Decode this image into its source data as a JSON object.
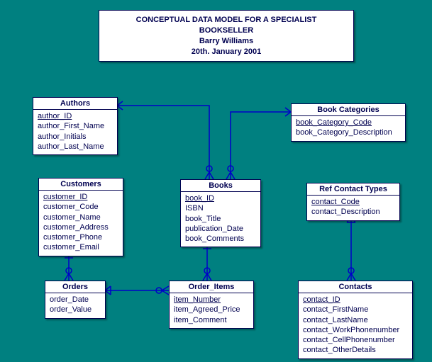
{
  "title": {
    "line1": "CONCEPTUAL DATA MODEL FOR A SPECIALIST BOOKSELLER",
    "line2": "Barry Williams",
    "line3": "20th. January 2001"
  },
  "entities": {
    "authors": {
      "name": "Authors",
      "attrs": [
        "author_ID",
        "author_First_Name",
        "author_Initials",
        "author_Last_Name"
      ],
      "pk": [
        0
      ]
    },
    "book_categories": {
      "name": "Book Categories",
      "attrs": [
        "book_Category_Code",
        "book_Category_Description"
      ],
      "pk": [
        0
      ]
    },
    "customers": {
      "name": "Customers",
      "attrs": [
        "customer_ID",
        "customer_Code",
        "customer_Name",
        "customer_Address",
        "customer_Phone",
        "customer_Email"
      ],
      "pk": [
        0
      ]
    },
    "books": {
      "name": "Books",
      "attrs": [
        "book_ID",
        "ISBN",
        "book_Title",
        "publication_Date",
        "book_Comments"
      ],
      "pk": [
        0
      ]
    },
    "ref_contact_types": {
      "name": "Ref Contact Types",
      "attrs": [
        "contact_Code",
        "contact_Description"
      ],
      "pk": [
        0
      ]
    },
    "orders": {
      "name": "Orders",
      "attrs": [
        "order_Date",
        "order_Value"
      ],
      "pk": []
    },
    "order_items": {
      "name": "Order_Items",
      "attrs": [
        "item_Number",
        "item_Agreed_Price",
        "item_Comment"
      ],
      "pk": [
        0
      ]
    },
    "contacts": {
      "name": "Contacts",
      "attrs": [
        "contact_ID",
        "contact_FirstName",
        "contact_LastName",
        "contact_WorkPhonenumber",
        "contact_CellPhonenumber",
        "contact_OtherDetails"
      ],
      "pk": [
        0
      ]
    }
  }
}
